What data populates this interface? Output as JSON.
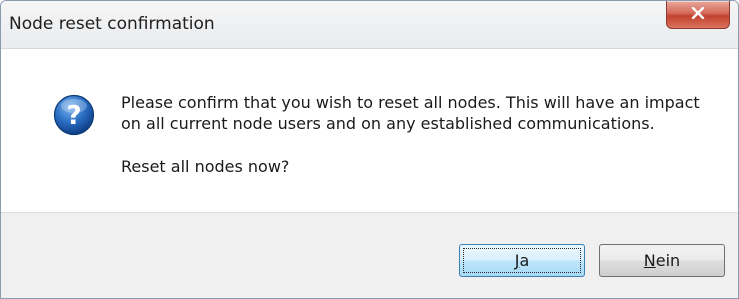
{
  "window": {
    "title": "Node reset confirmation",
    "close_icon": "close-icon"
  },
  "message": {
    "icon": "question-icon",
    "line1": "Please confirm that you wish to reset all nodes. This will have an impact",
    "line2": "on all current node users and on any established communications.",
    "prompt": "Reset all nodes now?"
  },
  "buttons": {
    "yes": {
      "mnemonic": "J",
      "rest": "a"
    },
    "no": {
      "mnemonic": "N",
      "rest": "ein"
    }
  },
  "colors": {
    "close_button": "#c7483a",
    "default_button_border": "#3c7fb1",
    "footer_background": "#f0f0f0",
    "question_icon": "#1d5fb0"
  }
}
